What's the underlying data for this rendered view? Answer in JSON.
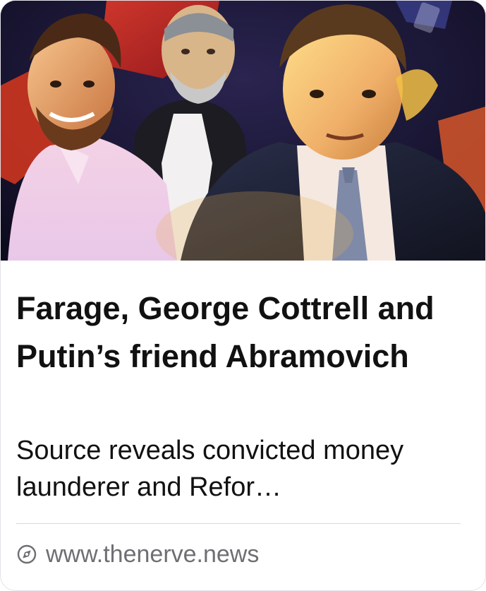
{
  "card": {
    "headline": "Farage, George Cottrell and Putin’s friend Abramovich",
    "description": "Source reveals convicted money launderer and Refor…",
    "domain": "www.thenerve.news",
    "link_icon": "compass-icon"
  },
  "colors": {
    "headline": "#111111",
    "description": "#111111",
    "domain": "#6e6e73",
    "divider": "#d9d9de"
  }
}
